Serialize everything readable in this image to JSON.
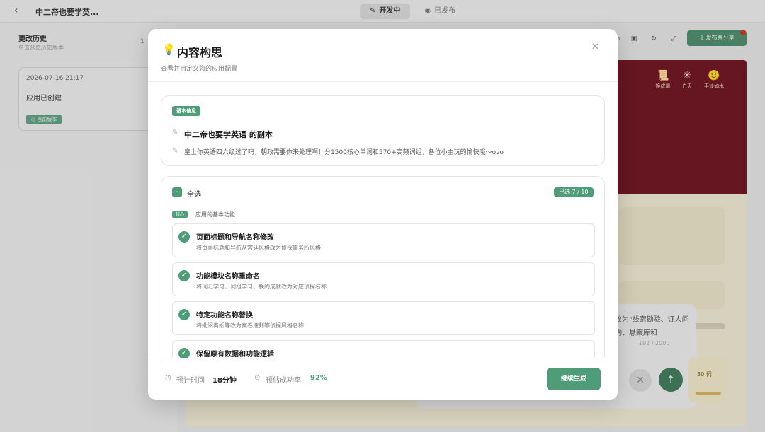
{
  "app": {
    "title": "中二帝也要学英...",
    "mode_tabs": [
      {
        "label": "开发中",
        "icon": "pencil-icon",
        "active": true
      },
      {
        "label": "已发布",
        "icon": "eye-icon",
        "active": false
      }
    ]
  },
  "history": {
    "title": "更改历史",
    "subtitle": "单击预览历史版本",
    "count": "1",
    "versions": [
      {
        "date": "2026-07-16 21:17",
        "message": "应用已创建",
        "badge": "当前版本"
      }
    ]
  },
  "workspace": {
    "publish_label": "发布并分享",
    "preview_stats": [
      {
        "icon": "scroll-icon",
        "glyph": "📜",
        "label": "换成册"
      },
      {
        "icon": "sun-icon",
        "glyph": "☀",
        "label": "白天"
      },
      {
        "icon": "smile-icon",
        "glyph": "🙂",
        "label": "平淡如水"
      }
    ],
    "input_text": "改为\"线索勘验、证人问询、悬案库和",
    "input_count": "192 / 2000",
    "word_chip": "30 词"
  },
  "modal": {
    "title": "内容构思",
    "subtitle": "查看并自定义您的应用配置",
    "basic_info": {
      "tag": "基本信息",
      "name": "中二帝也要学英语 的副本",
      "description": "皇上你英语四六级过了吗，朝政需要你来处理啊！分1500核心单词和570+高频词组，各位小主玩的愉快哦～ovo"
    },
    "features": {
      "select_all_label": "全选",
      "selected_count": "已选 7 / 10",
      "group_tag": "核心",
      "group_label": "应用的基本功能",
      "items": [
        {
          "title": "页面标题和导航名称修改",
          "desc": "将页面标题和导航从宫廷风格改为侦探事务所风格"
        },
        {
          "title": "功能模块名称重命名",
          "desc": "将词汇学习、词组学习、朕的成就改为对应侦探名称"
        },
        {
          "title": "特定功能名称替换",
          "desc": "将批阅奏折等改为案卷速判等侦探风格名称"
        },
        {
          "title": "保留原有数据和功能逻辑",
          "desc": ""
        }
      ]
    },
    "footer": {
      "time_label": "预计时间",
      "time_value": "18分钟",
      "success_label": "预估成功率",
      "success_value": "92%",
      "generate_label": "继续生成"
    }
  },
  "colors": {
    "accent": "#4e9c78",
    "preview_header": "#6e1520",
    "preview_body": "#ebe6ce"
  }
}
